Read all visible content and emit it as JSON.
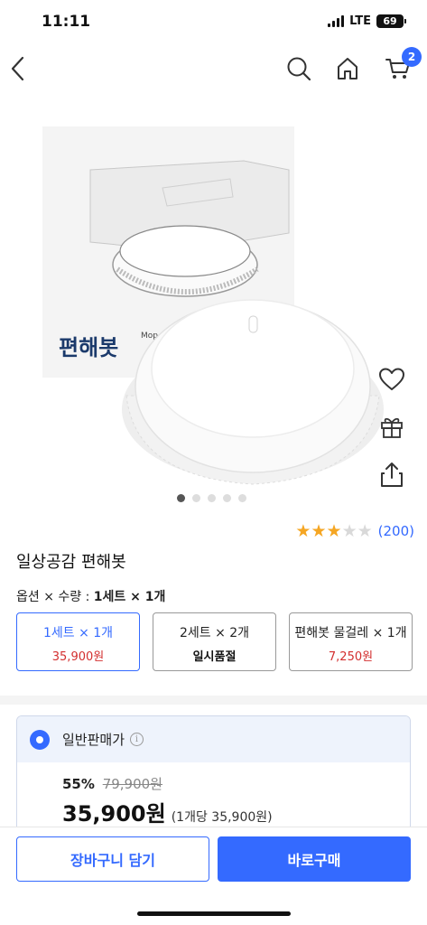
{
  "status_bar": {
    "time": "11:11",
    "network": "LTE",
    "battery": "69"
  },
  "nav": {
    "cart_count": "2"
  },
  "product_image": {
    "brand_text": "편해봇",
    "mop_text": "Mop"
  },
  "carousel": {
    "total": 5,
    "active_index": 0
  },
  "rating": {
    "stars": 3,
    "max": 5,
    "review_count": "(200)"
  },
  "product": {
    "title": "일상공감 편해봇"
  },
  "options": {
    "label": "옵션 × 수량 : ",
    "selected_text": "1세트 × 1개",
    "items": [
      {
        "name": "1세트 × 1개",
        "price": "35,900원",
        "selected": true
      },
      {
        "name": "2세트 × 2개",
        "status": "일시품절",
        "selected": false
      },
      {
        "name": "편해봇 물걸레 × 1개",
        "price": "7,250원",
        "selected": false
      }
    ]
  },
  "seller": {
    "type": "일반판매가",
    "discount_rate": "55%",
    "original_price": "79,900원",
    "sale_price": "35,900원",
    "unit_price": "(1개당 35,900원)"
  },
  "bottom": {
    "cart_button": "장바구니 담기",
    "buy_button": "바로구매"
  },
  "colors": {
    "accent": "#346aff",
    "price_red": "#d32f2f",
    "star": "#f5a623"
  }
}
